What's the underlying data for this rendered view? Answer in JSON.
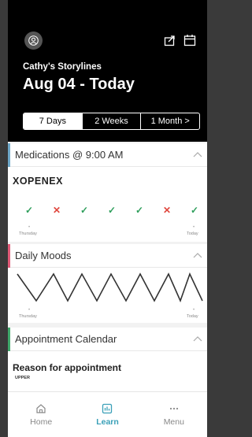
{
  "header": {
    "subtitle": "Cathy's Storylines",
    "title": "Aug 04 - Today",
    "icons": [
      "user-icon",
      "share-icon",
      "calendar-icon"
    ]
  },
  "range_tabs": [
    {
      "label": "7 Days",
      "active": true
    },
    {
      "label": "2 Weeks",
      "active": false
    },
    {
      "label": "1 Month >",
      "active": false
    }
  ],
  "medications": {
    "header": "Medications @ 9:00 AM",
    "accent_color": "#6fa8c8",
    "name": "XOPENEX",
    "marks": [
      "✓",
      "✕",
      "✓",
      "✓",
      "✓",
      "✕",
      "✓"
    ],
    "statuses": [
      "taken",
      "missed",
      "taken",
      "taken",
      "taken",
      "missed",
      "taken"
    ],
    "axis_start": "Thursday",
    "axis_end": "Today"
  },
  "moods": {
    "header": "Daily Moods",
    "accent_color": "#e05a78",
    "axis_start": "Thursday",
    "axis_end": "Today"
  },
  "appointments": {
    "header": "Appointment Calendar",
    "accent_color": "#3fa86a",
    "reason_label": "Reason for appointment",
    "reason_value": "UPPER"
  },
  "tabbar": {
    "items": [
      {
        "label": "Home",
        "icon": "home-icon",
        "active": false
      },
      {
        "label": "Learn",
        "icon": "learn-icon",
        "active": true
      },
      {
        "label": "Menu",
        "icon": "menu-icon",
        "active": false
      }
    ],
    "active_color": "#3aa0b8"
  }
}
